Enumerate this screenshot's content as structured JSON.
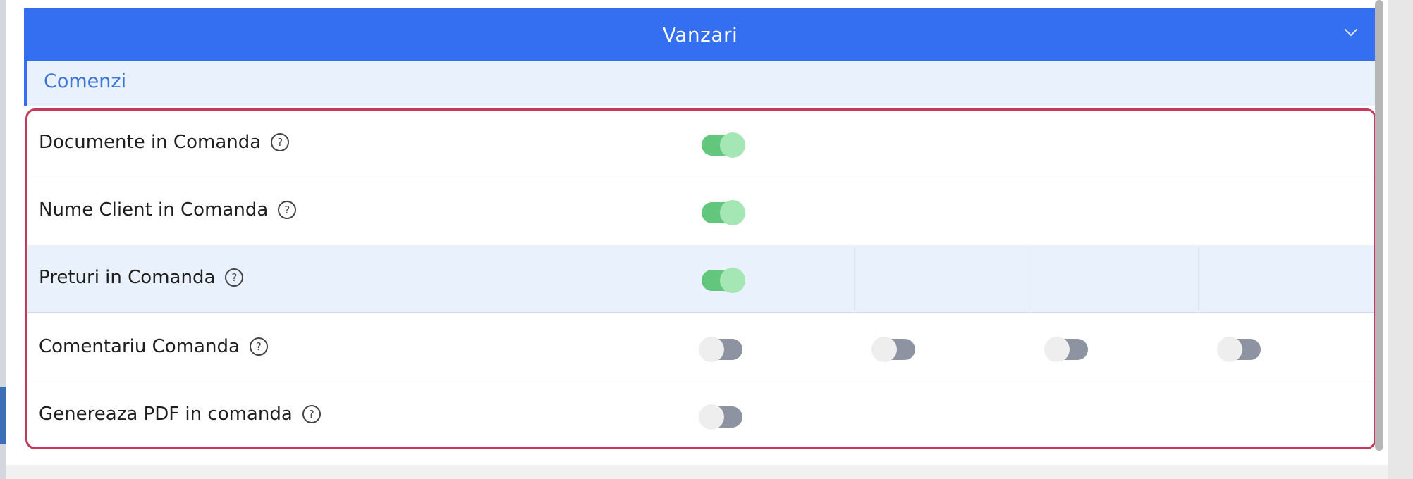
{
  "panel": {
    "title": "Vanzari",
    "collapse_icon": "chevron-down-icon",
    "accent_color": "#346ff1"
  },
  "section": {
    "label": "Comenzi"
  },
  "settings": [
    {
      "label": "Documente in Comanda",
      "help_icon": "help-circle-icon",
      "toggles": [
        true
      ]
    },
    {
      "label": "Nume Client in Comanda",
      "help_icon": "help-circle-icon",
      "toggles": [
        true
      ]
    },
    {
      "label": "Preturi in Comanda",
      "help_icon": "help-circle-icon",
      "toggles": [
        true
      ]
    },
    {
      "label": "Comentariu Comanda",
      "help_icon": "help-circle-icon",
      "toggles": [
        false,
        false,
        false,
        false
      ]
    },
    {
      "label": "Genereaza PDF in comanda",
      "help_icon": "help-circle-icon",
      "toggles": [
        false
      ]
    }
  ],
  "colors": {
    "toggle_on": "#62c77c",
    "toggle_off": "#8d93a1",
    "highlight_border": "#c23a5c",
    "section_bg": "#e8f1fc"
  }
}
